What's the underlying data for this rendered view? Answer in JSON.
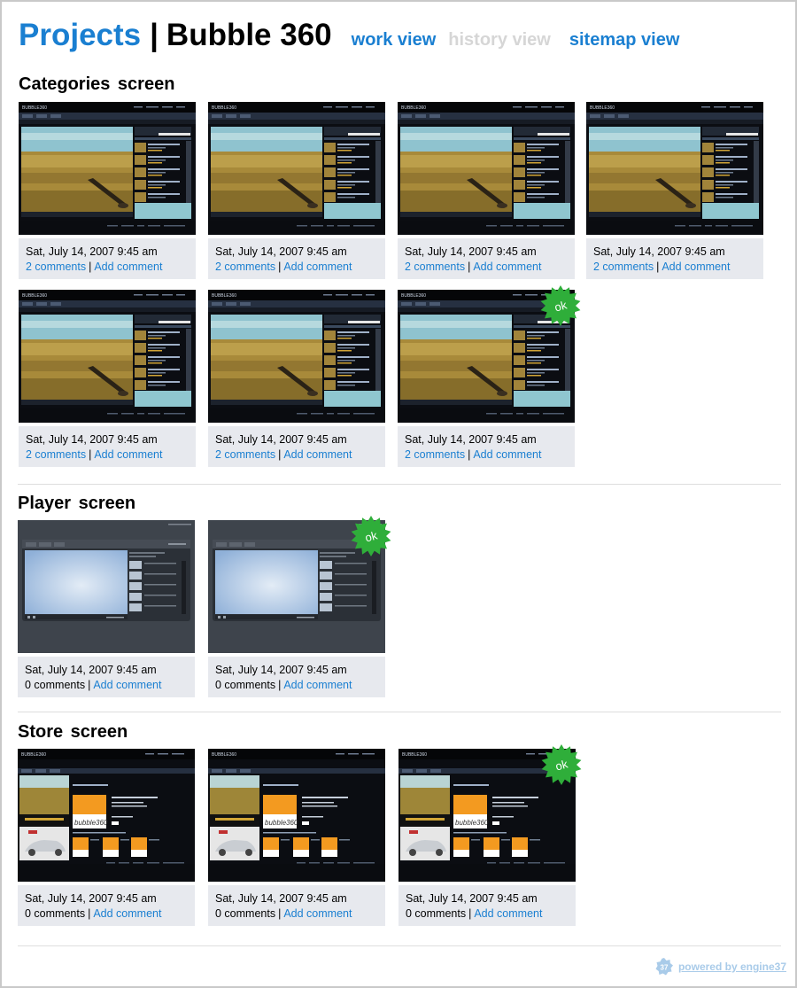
{
  "header": {
    "projects_label": "Projects",
    "separator": "|",
    "project_title": "Bubble 360",
    "views": [
      {
        "label": "work view",
        "state": "active"
      },
      {
        "label": "history view",
        "state": "disabled"
      },
      {
        "label": "sitemap view",
        "state": "link"
      }
    ]
  },
  "sections": [
    {
      "title": "Categories screen",
      "thumb_type": "categories",
      "cards": [
        {
          "date": "Sat, July 14, 2007 9:45 am",
          "comments": "2 comments",
          "comments_is_link": true,
          "add": "Add comment",
          "approved": false
        },
        {
          "date": "Sat, July 14, 2007 9:45 am",
          "comments": "2 comments",
          "comments_is_link": true,
          "add": "Add comment",
          "approved": false
        },
        {
          "date": "Sat, July 14, 2007 9:45 am",
          "comments": "2 comments",
          "comments_is_link": true,
          "add": "Add comment",
          "approved": false
        },
        {
          "date": "Sat, July 14, 2007 9:45 am",
          "comments": "2 comments",
          "comments_is_link": true,
          "add": "Add comment",
          "approved": false
        },
        {
          "date": "Sat, July 14, 2007 9:45 am",
          "comments": "2 comments",
          "comments_is_link": true,
          "add": "Add comment",
          "approved": false
        },
        {
          "date": "Sat, July 14, 2007 9:45 am",
          "comments": "2 comments",
          "comments_is_link": true,
          "add": "Add comment",
          "approved": false
        },
        {
          "date": "Sat, July 14, 2007 9:45 am",
          "comments": "2 comments",
          "comments_is_link": true,
          "add": "Add comment",
          "approved": true
        }
      ]
    },
    {
      "title": "Player screen",
      "thumb_type": "player",
      "cards": [
        {
          "date": "Sat, July 14, 2007 9:45 am",
          "comments": "0 comments",
          "comments_is_link": false,
          "add": "Add comment",
          "approved": false
        },
        {
          "date": "Sat, July 14, 2007 9:45 am",
          "comments": "0 comments",
          "comments_is_link": false,
          "add": "Add comment",
          "approved": true
        }
      ]
    },
    {
      "title": "Store screen",
      "thumb_type": "store",
      "cards": [
        {
          "date": "Sat, July 14, 2007 9:45 am",
          "comments": "0 comments",
          "comments_is_link": false,
          "add": "Add comment",
          "approved": false
        },
        {
          "date": "Sat, July 14, 2007 9:45 am",
          "comments": "0 comments",
          "comments_is_link": false,
          "add": "Add comment",
          "approved": false
        },
        {
          "date": "Sat, July 14, 2007 9:45 am",
          "comments": "0 comments",
          "comments_is_link": false,
          "add": "Add comment",
          "approved": true
        }
      ]
    }
  ],
  "badge_label": "ok",
  "meta_separator": "|",
  "footer": {
    "logo_number": "37",
    "text": "powered by engine37"
  },
  "colors": {
    "link": "#1a7fd1",
    "disabled": "#d6d6d6",
    "meta_bg": "#e7e9ee",
    "badge": "#2fae3a",
    "footer": "#a9cbe9"
  }
}
